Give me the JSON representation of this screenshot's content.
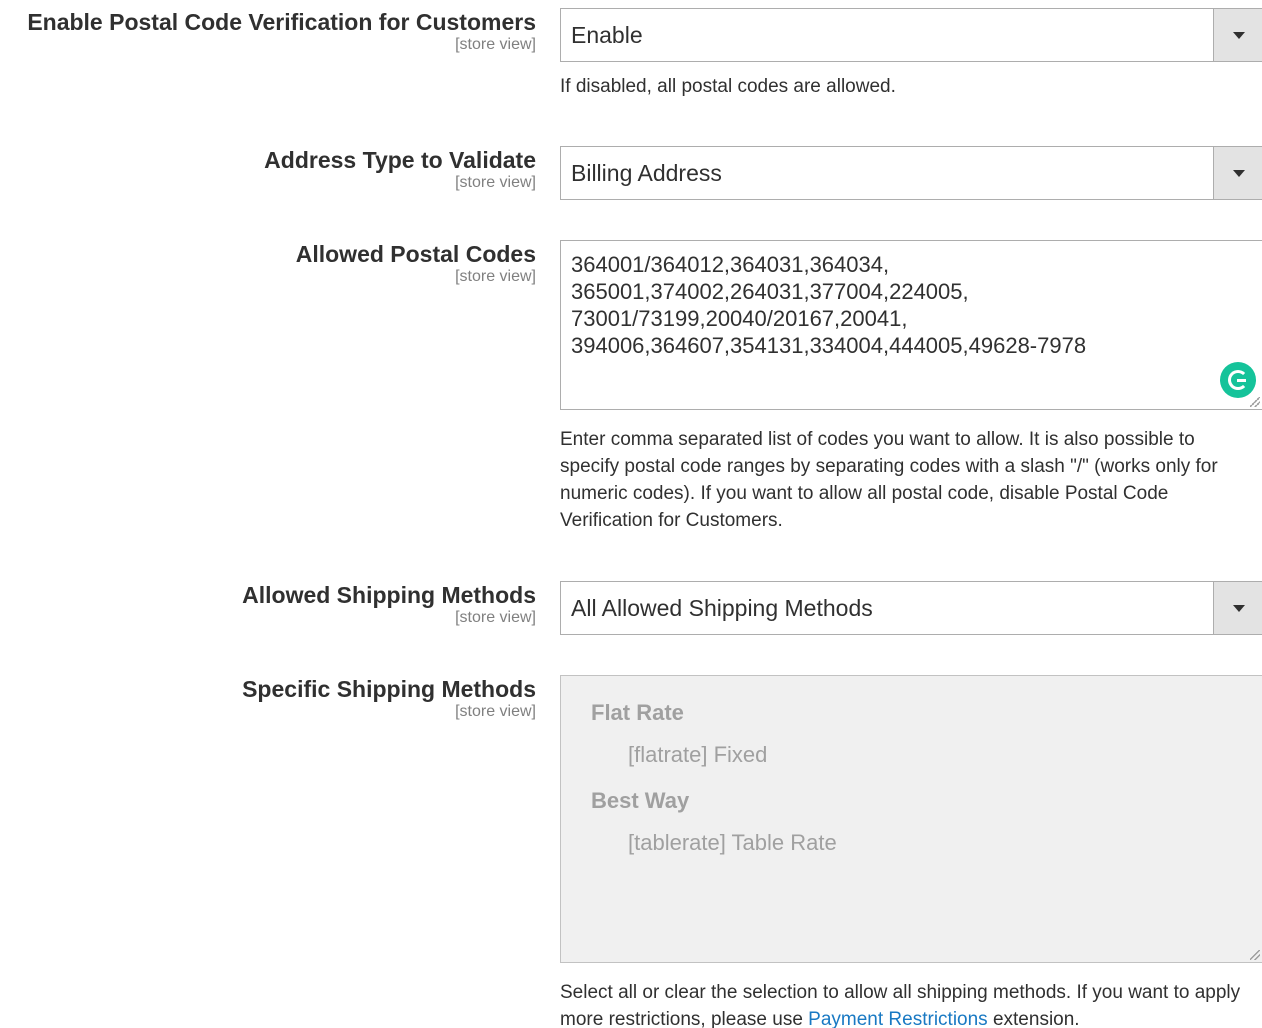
{
  "fields": {
    "postal_verification": {
      "label": "Enable Postal Code Verification for Customers",
      "scope": "[store view]",
      "value": "Enable",
      "note": "If disabled, all postal codes are allowed."
    },
    "address_type": {
      "label": "Address Type to Validate",
      "scope": "[store view]",
      "value": "Billing Address"
    },
    "allowed_codes": {
      "label": "Allowed Postal Codes",
      "scope": "[store view]",
      "lines": [
        "364001/364012,364031,364034,",
        "365001,374002,264031,377004,224005,",
        "73001/73199,20040/20167,20041,",
        "394006,364607,354131,334004,444005,49628-7978"
      ],
      "note": "Enter comma separated list of codes you want to allow. It is also possible to specify postal code ranges by separating codes with a slash \"/\" (works only for numeric codes). If you want to allow all postal code, disable Postal Code Verification for Customers."
    },
    "shipping_methods": {
      "label": "Allowed Shipping Methods",
      "scope": "[store view]",
      "value": "All Allowed Shipping Methods"
    },
    "specific_methods": {
      "label": "Specific Shipping Methods",
      "scope": "[store view]",
      "groups": [
        {
          "label": "Flat Rate",
          "option": "[flatrate] Fixed"
        },
        {
          "label": "Best Way",
          "option": "[tablerate] Table Rate"
        }
      ],
      "note_before": "Select all or clear the selection to allow all shipping methods. If you want to apply more restrictions, please use ",
      "note_link": "Payment Restrictions",
      "note_after": " extension."
    }
  },
  "colors": {
    "link": "#1979c3",
    "grammarly": "#15c39a"
  }
}
